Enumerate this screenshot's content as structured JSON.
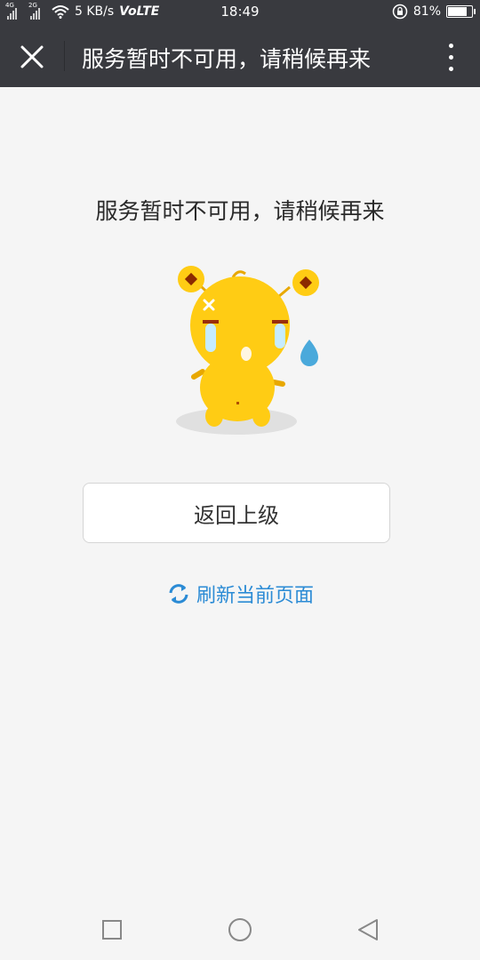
{
  "status_bar": {
    "signal1_tag": "4G",
    "signal2_tag": "2G",
    "net_speed": "5 KB/s",
    "network": "VoLTE",
    "time": "18:49",
    "battery": "81%",
    "battery_level": 0.81
  },
  "title_bar": {
    "title": "服务暂时不可用，请稍候再来",
    "close_icon": "close-icon",
    "more_icon": "more-vert-icon"
  },
  "content": {
    "message": "服务暂时不可用，请稍候再来",
    "back_button": "返回上级",
    "refresh_link": "刷新当前页面"
  },
  "colors": {
    "header_bg": "#393a3f",
    "page_bg": "#f5f5f5",
    "link_blue": "#2b8bd5",
    "mascot_yellow": "#ffcc14"
  },
  "nav_bar": {
    "icons": [
      "square-recents-icon",
      "circle-home-icon",
      "triangle-back-icon"
    ]
  }
}
